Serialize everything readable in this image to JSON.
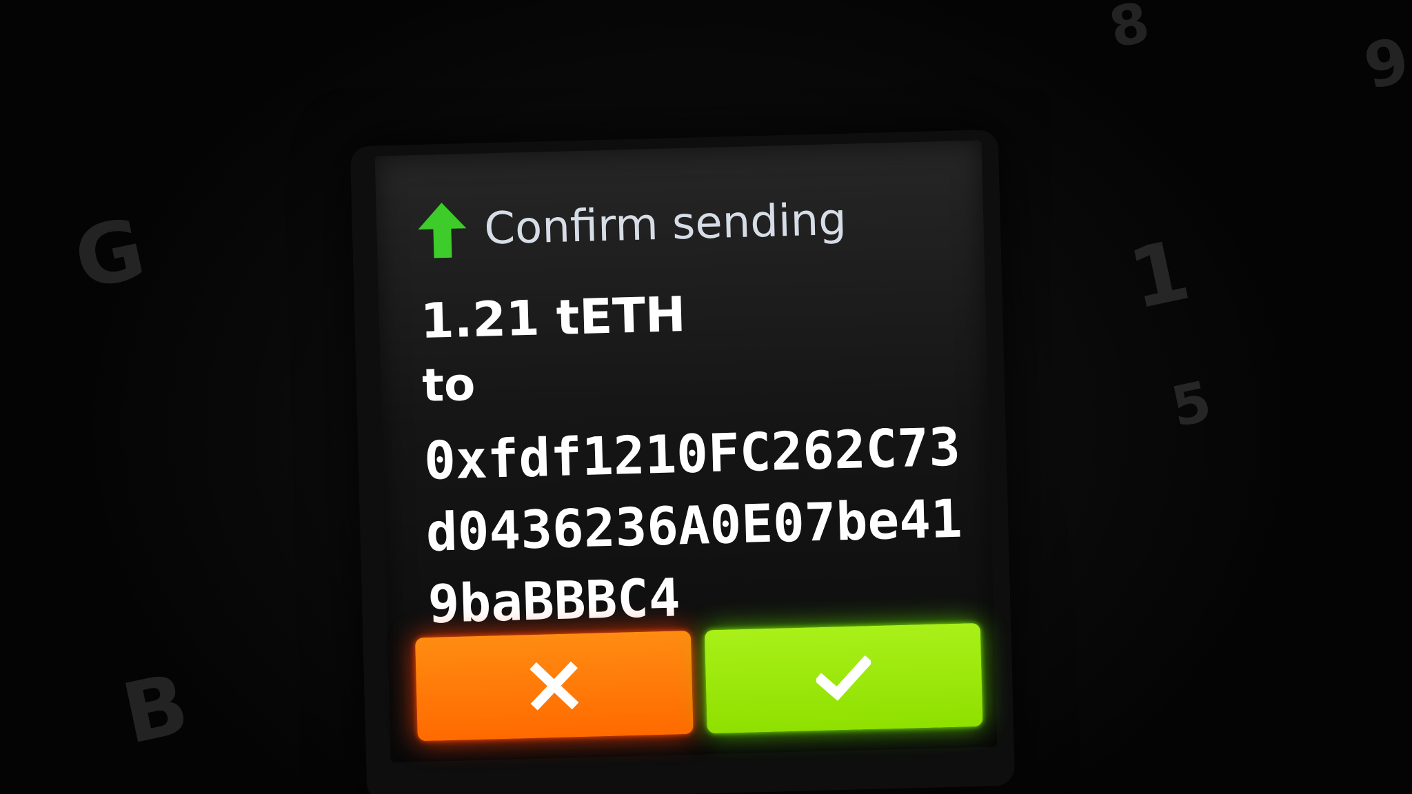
{
  "screen": {
    "title": "Confirm sending",
    "header_icon": "up-arrow-icon",
    "amount": "1.21 tETH",
    "to_label": "to",
    "address_lines": [
      "0xfdf1210FC262C73",
      "d0436236A0E07be41",
      "9baBBBC4"
    ]
  },
  "buttons": {
    "cancel_icon": "close-icon",
    "confirm_icon": "check-icon"
  },
  "background_keys": [
    "G",
    "B",
    "8",
    "9",
    "5",
    "1"
  ],
  "colors": {
    "arrow": "#3dcc2a",
    "cancel": "#ff7a00",
    "confirm": "#9ae80d",
    "title_text": "#d7dde6",
    "body_text": "#ffffff"
  }
}
